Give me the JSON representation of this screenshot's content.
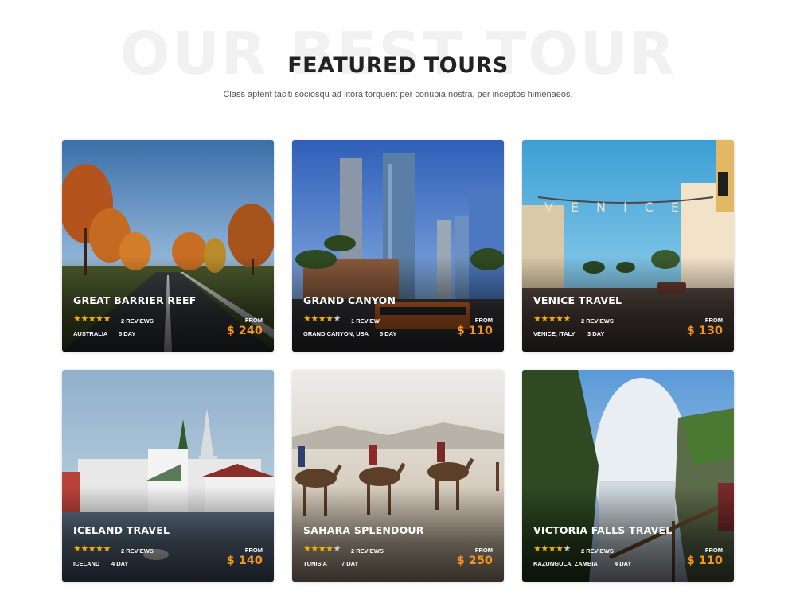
{
  "header": {
    "background_text": "OUR BEST TOUR",
    "title": "FEATURED TOURS",
    "subtitle": "Class aptent taciti sociosqu ad litora torquent per conubia nostra, per inceptos himenaeos."
  },
  "colors": {
    "accent_price": "#f7941d",
    "star": "#f5b301"
  },
  "tours": [
    {
      "name": "GREAT BARRIER REEF",
      "rating": 5,
      "reviews": "2 REVIEWS",
      "place": "AUSTRALIA",
      "days": "5 DAY",
      "from_label": "FROM",
      "price": "$ 240",
      "stars": "★★★★★"
    },
    {
      "name": "GRAND CANYON",
      "rating": 4,
      "reviews": "1 REVIEW",
      "place": "GRAND CANYON, USA",
      "days": "5 DAY",
      "from_label": "FROM",
      "price": "$ 110",
      "stars": "★★★★★"
    },
    {
      "name": "VENICE TRAVEL",
      "rating": 5,
      "reviews": "2 REVIEWS",
      "place": "VENICE, ITALY",
      "days": "3 DAY",
      "from_label": "FROM",
      "price": "$ 130",
      "stars": "★★★★★"
    },
    {
      "name": "ICELAND TRAVEL",
      "rating": 5,
      "reviews": "2 REVIEWS",
      "place": "ICELAND",
      "days": "4 DAY",
      "from_label": "FROM",
      "price": "$ 140",
      "stars": "★★★★★"
    },
    {
      "name": "SAHARA SPLENDOUR",
      "rating": 4,
      "reviews": "2 REVIEWS",
      "place": "TUNISIA",
      "days": "7 DAY",
      "from_label": "FROM",
      "price": "$ 250",
      "stars": "★★★★★"
    },
    {
      "name": "VICTORIA FALLS TRAVEL",
      "rating": 4,
      "reviews": "2 REVIEWS",
      "place": "KAZUNGULA, ZAMBIA",
      "days": "4 DAY",
      "from_label": "FROM",
      "price": "$ 110",
      "stars": "★★★★★"
    }
  ]
}
